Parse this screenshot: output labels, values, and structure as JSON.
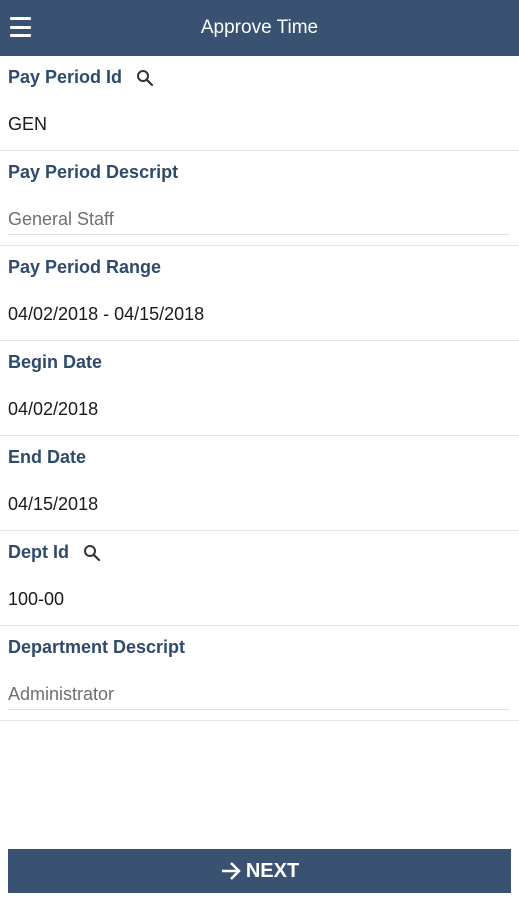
{
  "header": {
    "title": "Approve Time",
    "menu_icon": "hamburger-menu-icon"
  },
  "fields": [
    {
      "label": "Pay Period Id",
      "value": "GEN",
      "searchable": true
    },
    {
      "label": "Pay Period Descript",
      "value": "General Staff",
      "searchable": false
    },
    {
      "label": "Pay Period Range",
      "value": "04/02/2018 - 04/15/2018",
      "searchable": false
    },
    {
      "label": "Begin Date",
      "value": "04/02/2018",
      "searchable": false
    },
    {
      "label": "End Date",
      "value": "04/15/2018",
      "searchable": false
    },
    {
      "label": "Dept Id",
      "value": "100-00",
      "searchable": true
    },
    {
      "label": "Department Descript",
      "value": "Administrator",
      "searchable": false
    }
  ],
  "footer": {
    "next_label": "NEXT",
    "next_icon": "arrow-right-icon"
  },
  "colors": {
    "primary": "#3a5272",
    "label": "#2e4a6c"
  }
}
